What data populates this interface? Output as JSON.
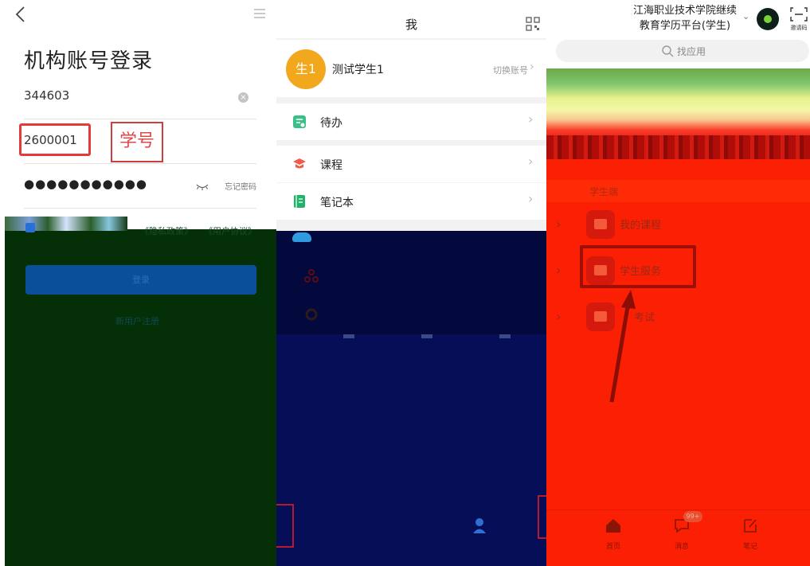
{
  "login_screen": {
    "title": "机构账号登录",
    "org_code": "344603",
    "student_id": "2600001",
    "password_mask": "●●●●●●●●●●●",
    "forgot_password": "忘记密码",
    "annotation_label": "学号",
    "agreement_privacy": "《隐私政策》",
    "agreement_user": "《用户协议》",
    "login_button": "登录",
    "new_user": "新用户注册"
  },
  "me_screen": {
    "title": "我",
    "avatar_text": "生1",
    "user_name": "测试学生1",
    "switch_account": "切换账号",
    "menu": [
      {
        "label": "待办",
        "icon": "todo-icon",
        "color": "#3cc08a"
      },
      {
        "label": "课程",
        "icon": "course-icon",
        "color": "#f05a4a"
      },
      {
        "label": "笔记本",
        "icon": "notebook-icon",
        "color": "#20b46a"
      }
    ]
  },
  "student_app": {
    "school_name_line1": "江海职业技术学院继续",
    "school_name_line2": "教育学历平台(学生)",
    "invite_code": "邀请码",
    "search_placeholder": "找应用",
    "section_title": "学生端",
    "items": [
      {
        "label": "我的课程",
        "icon": "course-icon"
      },
      {
        "label": "学生服务",
        "icon": "service-icon"
      },
      {
        "label": "考试",
        "icon": "exam-icon"
      }
    ],
    "tabs": [
      {
        "label": "首页",
        "icon": "home-icon"
      },
      {
        "label": "消息",
        "icon": "message-icon"
      },
      {
        "label": "笔记",
        "icon": "note-icon"
      }
    ],
    "message_badge": "99+"
  },
  "colors": {
    "brand_blue": "#0a4f9a",
    "highlight_red": "#e63a3a",
    "avatar_orange": "#f2a81d",
    "login_overlay": "#053007",
    "me_overlay": "#04093d",
    "app_overlay": "#fb1f03"
  }
}
